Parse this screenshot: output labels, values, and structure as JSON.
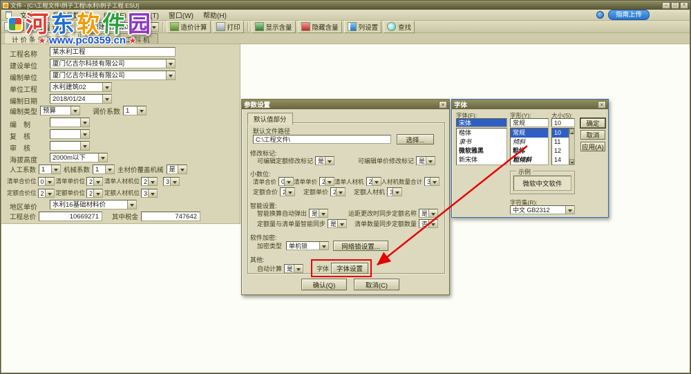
{
  "window": {
    "title": "文件 - [C:\\工程文件\\例子工程\\水利\\例子工程.ESU]"
  },
  "icons": {
    "minimize": "–",
    "maximize": "□",
    "close": "×",
    "star": "★"
  },
  "watermark": {
    "chars": [
      "河",
      "东",
      "软",
      "件",
      "园"
    ],
    "url": "www.pc0359.cn"
  },
  "menubar": {
    "items": [
      "文件(F)",
      "系统参数配置",
      "编辑(E)",
      "查看(T)",
      "窗口(W)",
      "帮助(H)"
    ],
    "guide_button": "指南上传"
  },
  "toolbar": {
    "calculator": "计算器",
    "template": "水利建筑预算02",
    "buttons": [
      "造价计算",
      "打印",
      "显示含量",
      "隐藏含量",
      "列设置",
      "查找"
    ]
  },
  "tabs": [
    "计价条件及费率",
    "工程量",
    "工料机"
  ],
  "form": {
    "project_name": {
      "label": "工程名称",
      "value": "某水利工程"
    },
    "build_unit": {
      "label": "建设单位",
      "value": "厦门亿吉尔科技有限公司"
    },
    "compile_unit": {
      "label": "编制单位",
      "value": "厦门亿吉尔科技有限公司"
    },
    "unit_project": {
      "label": "单位工程",
      "value": "水利建筑02"
    },
    "compile_date": {
      "label": "编制日期",
      "value": "2018/01/24"
    },
    "compile_type": {
      "label": "编制类型",
      "value": "预算"
    },
    "price_adjust": {
      "label": "调价系数",
      "value": "1"
    },
    "compiler": {
      "label": "编　制",
      "value": ""
    },
    "checker": {
      "label": "复　核",
      "value": ""
    },
    "auditor": {
      "label": "审　核",
      "value": ""
    },
    "altitude": {
      "label": "海拔高度",
      "value": "2000m以下"
    },
    "labor_coef": {
      "label": "人工系数",
      "value": "1"
    },
    "machine_coef": {
      "label": "机械系数",
      "value": "1"
    },
    "main_override": {
      "label": "主材价覆盖机械",
      "value": "是"
    },
    "list_total_digits": {
      "label": "清单合价位",
      "value": "0"
    },
    "list_unit_digits": {
      "label": "清单单价位",
      "value": "2"
    },
    "list_rcj_digits": {
      "label": "清单人材机位",
      "value": "2"
    },
    "rcj_qty_digits": {
      "value": "3"
    },
    "quota_total_digits": {
      "label": "定额合价位",
      "value": "2"
    },
    "quota_unit_digits": {
      "label": "定额单价位",
      "value": "2"
    },
    "quota_rcj_digits": {
      "label": "定额人材机位",
      "value": "3"
    },
    "region_price": {
      "label": "地区单价",
      "value": "水利16基础材料价"
    },
    "project_total": {
      "label": "工程总价",
      "value": "10669271"
    },
    "tax": {
      "label": "其中税金",
      "value": "747642"
    }
  },
  "params_dialog": {
    "title": "参数设置",
    "tab": "默认值部分",
    "default_path_label": "默认文件路径",
    "default_path": "C:\\工程文件\\",
    "choose_button": "选择...",
    "sections": {
      "modify": "修改标记:",
      "decimal": "小数位:",
      "smart": "智能设置:",
      "encrypt": "软件加密:",
      "other": "其他:"
    },
    "fields": {
      "quota_mark": {
        "label": "可编辑定额修改标记",
        "value": "是"
      },
      "price_mark": {
        "label": "可编辑单价修改标记",
        "value": "是"
      },
      "list_total": {
        "label": "清单合价",
        "value": "0"
      },
      "list_unit": {
        "label": "清单单价",
        "value": "2"
      },
      "list_rcj": {
        "label": "清单人材机",
        "value": "2"
      },
      "rcj_qty": {
        "label": "人材机数量合计",
        "value": "3"
      },
      "quota_total": {
        "label": "定额合价",
        "value": "2"
      },
      "quota_unit": {
        "label": "定额单价",
        "value": "2"
      },
      "quota_rcj": {
        "label": "定额人材机",
        "value": "3"
      },
      "smart_popup": {
        "label": "智能换算自动弹出",
        "value": "是"
      },
      "sync_name": {
        "label": "运距更改时同步定额名称",
        "value": "是"
      },
      "sync_qty": {
        "label": "定额量与清单量智能同步",
        "value": "是"
      },
      "sync_list": {
        "label": "清单数量同步定额数量",
        "value": "否"
      },
      "encrypt_type": {
        "label": "加密类型",
        "value": "单机锁"
      },
      "auto_calc": {
        "label": "自动计算",
        "value": "是"
      },
      "font": {
        "label": "字体"
      }
    },
    "network_button": "网络锁设置...",
    "font_button": "字体设置",
    "ok_button": "确认(Q)",
    "cancel_button": "取消(C)"
  },
  "font_dialog": {
    "title": "字体",
    "font_label": "字体(F):",
    "font_value": "宋体",
    "font_list": [
      "楷体",
      "隶书",
      "微软雅黑",
      "新宋体"
    ],
    "style_label": "字形(Y):",
    "style_value": "常规",
    "style_list": [
      "常规",
      "倾斜",
      "粗体",
      "粗倾斜"
    ],
    "size_label": "大小(S):",
    "size_value": "10",
    "size_list": [
      "10",
      "11",
      "12",
      "14"
    ],
    "ok_button": "确定",
    "cancel_button": "取消",
    "apply_button": "应用(A)",
    "sample_label": "示例",
    "sample_text": "微软中文软件",
    "charset_label": "字符集(R):",
    "charset_value": "中文 GB2312"
  },
  "annotation": {
    "color": "#e60000"
  }
}
